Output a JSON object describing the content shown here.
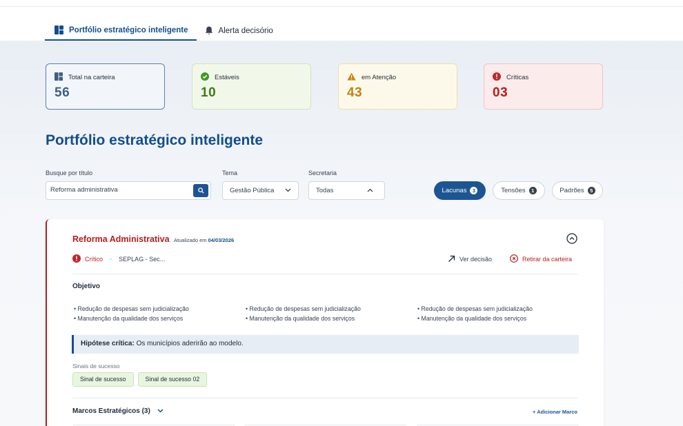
{
  "tabs": [
    {
      "label": "Portfólio estratégico inteligente",
      "active": true,
      "icon": "dashboard-icon"
    },
    {
      "label": "Alerta decisório",
      "active": false,
      "icon": "bell-icon"
    }
  ],
  "stats": {
    "total": {
      "label": "Total na carteira",
      "value": "56",
      "icon": "dashboard-icon"
    },
    "stable": {
      "label": "Estáveis",
      "value": "10",
      "icon": "check-circle-icon"
    },
    "attention": {
      "label": "em Atenção",
      "value": "43",
      "icon": "warning-triangle-icon"
    },
    "critical": {
      "label": "Críticas",
      "value": "03",
      "icon": "alert-circle-icon"
    }
  },
  "page_title": "Portfólio estratégico inteligente",
  "filters": {
    "search_label": "Busque por título",
    "search_value": "Reforma administrativa",
    "tema_label": "Tema",
    "tema_value": "Gestão Pública",
    "secretaria_label": "Secretaria",
    "secretaria_value": "Todas"
  },
  "chips": {
    "lacunas": {
      "label": "Lacunas",
      "count": "3"
    },
    "tensoes": {
      "label": "Tensões",
      "count": "1"
    },
    "padroes": {
      "label": "Padrões",
      "count": "5"
    }
  },
  "card": {
    "title": "Reforma Administrativa",
    "updated_prefix": "Atualizado em",
    "updated_date": "04/03/2026",
    "status": "Crítico",
    "org": "SEPLAG - Sec...",
    "view_decision": "Ver decisão",
    "remove": "Retirar da carteira",
    "objective_title": "Objetivo",
    "objective_columns": [
      [
        "Redução de despesas sem judicialização",
        "Manutenção da qualidade dos serviços"
      ],
      [
        "Redução de despesas sem judicialização",
        "Manutenção da qualidade dos serviços"
      ],
      [
        "Redução de despesas sem judicialização",
        "Manutenção da qualidade dos serviços"
      ]
    ],
    "hypothesis_label": "Hipótese crítica:",
    "hypothesis_text": "Os municípios aderirão ao modelo.",
    "signals_label": "Sinais de sucesso",
    "signals": [
      "Sinal de sucesso",
      "Sinal de sucesso 02"
    ],
    "marcos_label": "Marcos Estratégicos (3)",
    "add_marco": "+ Adicionar Marco"
  },
  "colors": {
    "primary": "#124e8c",
    "critical": "#b91c1c",
    "stable": "#3f7a17",
    "attention": "#c28213"
  }
}
